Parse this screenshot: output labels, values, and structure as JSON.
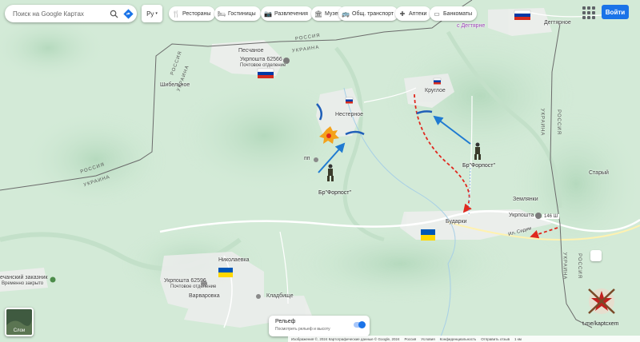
{
  "search": {
    "placeholder": "Поиск на Google Картах"
  },
  "language": {
    "value": "Ру"
  },
  "chips": [
    {
      "label": "Рестораны",
      "icon": "fork-knife-icon"
    },
    {
      "label": "Гостиницы",
      "icon": "bed-icon"
    },
    {
      "label": "Развлечения",
      "icon": "camera-icon"
    },
    {
      "label": "Музеи",
      "icon": "museum-icon"
    },
    {
      "label": "Общ. транспорт",
      "icon": "bus-icon"
    },
    {
      "label": "Аптеки",
      "icon": "pharmacy-icon"
    },
    {
      "label": "Банкоматы",
      "icon": "card-icon"
    }
  ],
  "signin": {
    "label": "Войти"
  },
  "places": {
    "pesch": "Песчаное",
    "ukr62566": "Укрпошта 62566",
    "post1": "Почтовое отделение",
    "shib": "Шибельное",
    "nest": "Нестерное",
    "krug": "Круглое",
    "degt": "Дегтярное",
    "degt2": "с Дегтярне",
    "starr": "Старый",
    "zeml": "Землянки",
    "ukr": "Укрпошта",
    "bud": "Бударки",
    "nik": "Николаевка",
    "ukr62596": "Укрпошта 62596",
    "post2": "Почтовое отделение",
    "var": "Варваровка",
    "klad": "Кладбище",
    "zakaz": "ечанский заказник",
    "zakaz2": "Временно закрыто",
    "pp": "пп",
    "road": "146 Ш",
    "road2": "Ил. Сидим"
  },
  "units": {
    "forpost1": "Бр\"Форпост\"",
    "forpost2": "Бр\"Форпост\""
  },
  "border": {
    "russia": "РОССИЯ",
    "ukraine": "УКРАИНА"
  },
  "layers": {
    "label": "Слои"
  },
  "relief": {
    "title": "Рельеф",
    "subtitle": "Посмотреть рельеф и высоту"
  },
  "footer": [
    "Изображения ©, 2024 Картографические данные © Google, 2024",
    "Россия",
    "Условия",
    "Конфиденциальность",
    "Отправить отзыв",
    "1 км"
  ],
  "credit": "t.me/kaptcxem",
  "colors": {
    "russia_flag": [
      "#ffffff",
      "#0039a6",
      "#d52b1e"
    ],
    "ukraine_flag": [
      "#0057b7",
      "#ffd700"
    ],
    "arrow_blue": "#1f7ad1",
    "arrow_red": "#e0281e",
    "accent": "#1a73e8"
  }
}
